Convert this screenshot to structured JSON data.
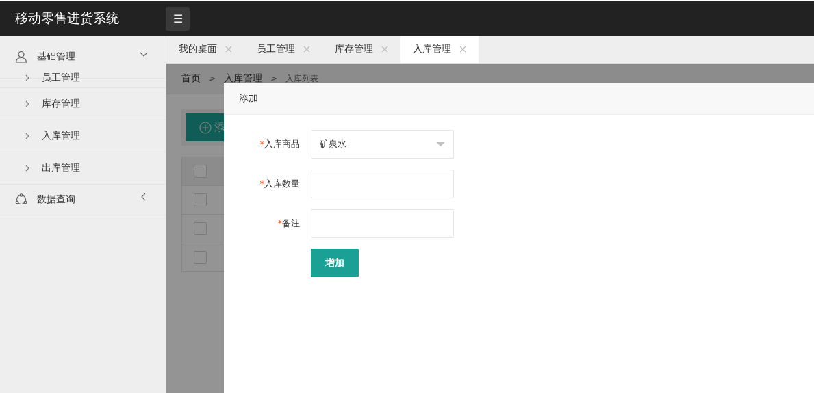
{
  "header": {
    "title": "移动零售进货系统",
    "menu_button": "☰"
  },
  "sidebar": {
    "groups": [
      {
        "label": "基础管理",
        "expanded": true,
        "children": [
          {
            "label": "员工管理"
          },
          {
            "label": "库存管理"
          },
          {
            "label": "入库管理"
          },
          {
            "label": "出库管理"
          }
        ]
      },
      {
        "label": "数据查询",
        "expanded": false
      }
    ]
  },
  "tabs": [
    {
      "label": "我的桌面",
      "selected": false
    },
    {
      "label": "员工管理",
      "selected": false
    },
    {
      "label": "库存管理",
      "selected": false
    },
    {
      "label": "入库管理",
      "selected": true
    }
  ],
  "breadcrumb": [
    {
      "kind": "link",
      "text": "首页"
    },
    {
      "kind": "separator",
      "text": ">"
    },
    {
      "kind": "link",
      "text": "入库管理"
    },
    {
      "kind": "separator",
      "text": ">"
    },
    {
      "kind": "current",
      "text": "入库列表"
    }
  ],
  "add_button": "添",
  "table": {
    "rows": [
      {
        "checked": false
      },
      {
        "checked": false
      },
      {
        "checked": false
      },
      {
        "checked": false
      }
    ]
  },
  "dialog": {
    "title": "添加",
    "fields": [
      {
        "kind": "select",
        "label": "入库商品",
        "required_mark": "*",
        "value": "矿泉水"
      },
      {
        "kind": "input",
        "label": "入库数量",
        "required_mark": "*"
      },
      {
        "kind": "input",
        "label": "备注",
        "required_mark": "*"
      }
    ],
    "submit": "增加"
  }
}
